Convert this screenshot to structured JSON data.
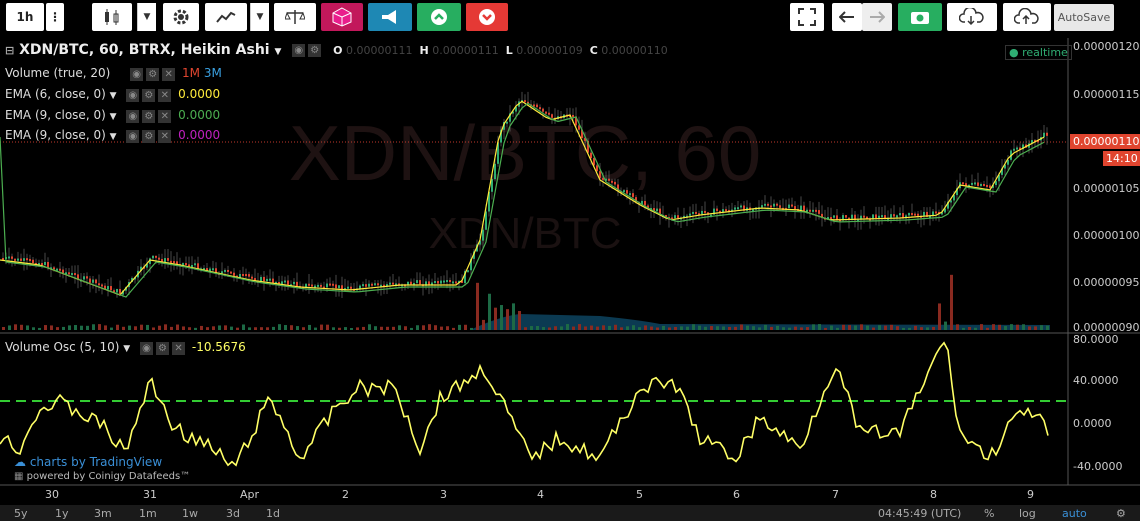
{
  "toolbar": {
    "interval": "1h",
    "autosave": "AutoSave"
  },
  "legend": {
    "title": "XDN/BTC, 60, BTRX, Heikin Ashi",
    "o_label": "O",
    "o_value": "0.00000111",
    "h_label": "H",
    "h_value": "0.00000111",
    "l_label": "L",
    "l_value": "0.00000109",
    "c_label": "C",
    "c_value": "0.00000110",
    "realtime": "realtime",
    "volume": "Volume (true, 20)",
    "vol_1m": "1M",
    "vol_3m": "3M",
    "ema1": "EMA (6, close, 0)",
    "ema1_val": "0.0000",
    "ema2": "EMA (9, close, 0)",
    "ema2_val": "0.0000",
    "ema3": "EMA (9, close, 0)",
    "ema3_val": "0.0000",
    "osc": "Volume Osc (5, 10)",
    "osc_val": "-10.5676"
  },
  "watermark": {
    "main": "XDN/BTC, 60",
    "sub": "XDN/BTC"
  },
  "price_axis": [
    "0.00000120",
    "0.00000115",
    "0.00000110",
    "0.00000105",
    "0.00000100",
    "0.00000095",
    "0.00000090"
  ],
  "last_price": "0.00000110",
  "countdown": "14:10",
  "osc_axis": [
    "80.0000",
    "40.0000",
    "0.0000",
    "-40.0000"
  ],
  "time_axis": [
    "30",
    "31",
    "Apr",
    "2",
    "3",
    "4",
    "5",
    "6",
    "7",
    "8",
    "9"
  ],
  "branding": {
    "line1": "charts by TradingView",
    "line2": "powered by Coinigy Datafeeds™"
  },
  "bottom": {
    "ranges": [
      "5y",
      "1y",
      "3m",
      "1m",
      "1w",
      "3d",
      "1d"
    ],
    "clock": "04:45:49 (UTC)",
    "pct": "%",
    "log": "log",
    "auto": "auto"
  },
  "colors": {
    "up": "#2fae73",
    "down": "#e0452f",
    "ema_yellow": "#ffeb3b",
    "ema_green": "#4caf50",
    "osc": "#ffff66",
    "dash": "#33cc33"
  }
}
